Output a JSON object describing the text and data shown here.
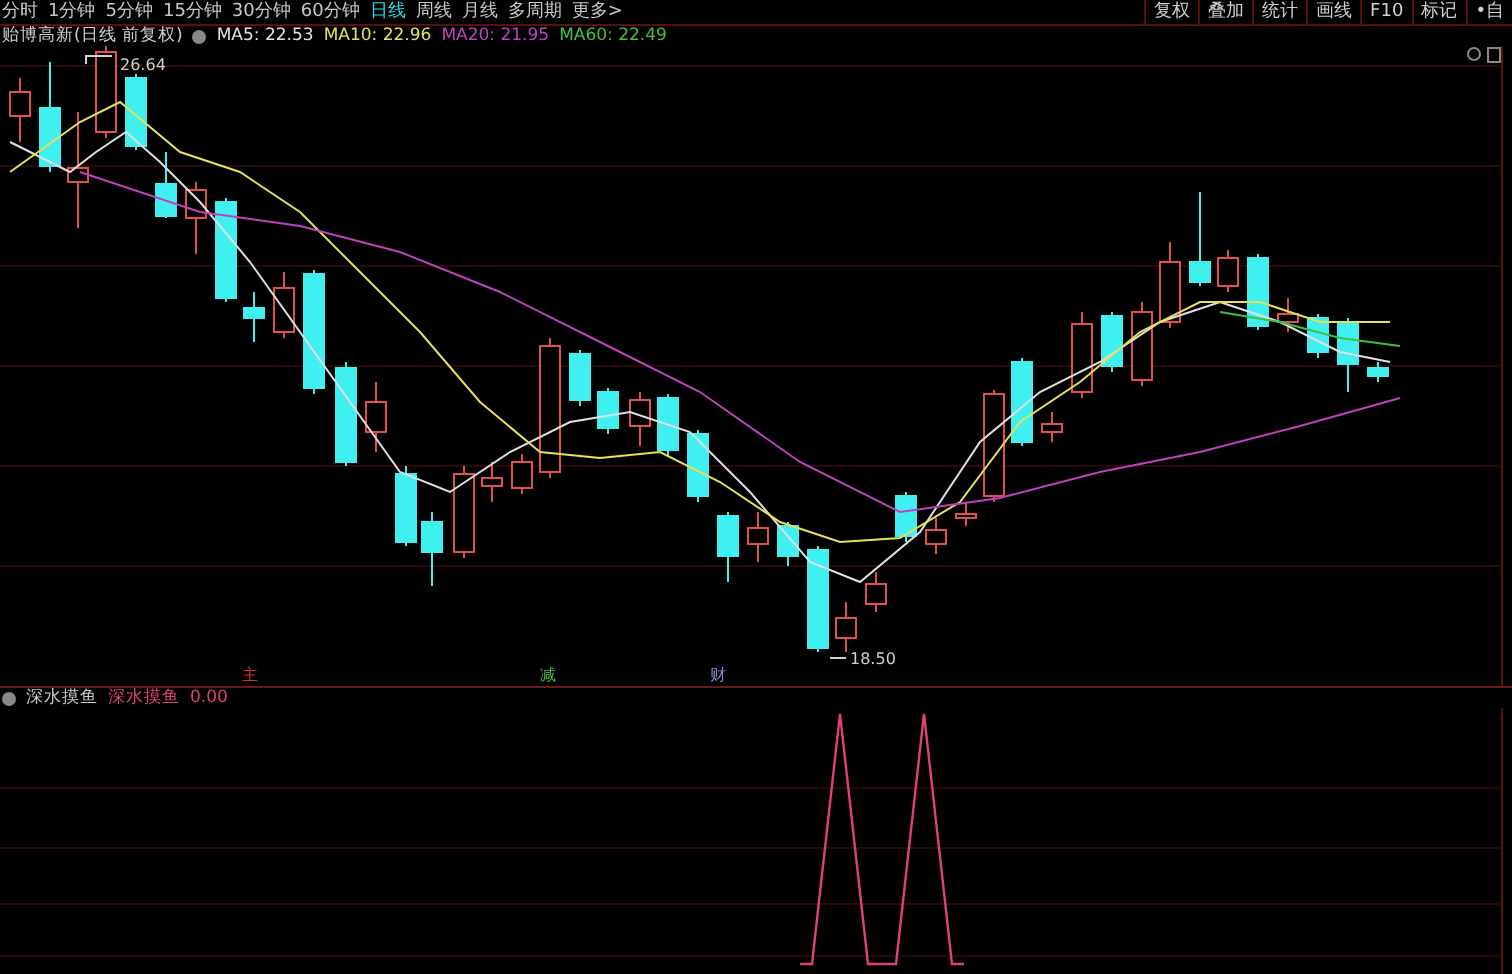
{
  "toolbar": {
    "periods": [
      {
        "label": "分时",
        "selected": false
      },
      {
        "label": "1分钟",
        "selected": false
      },
      {
        "label": "5分钟",
        "selected": false
      },
      {
        "label": "15分钟",
        "selected": false
      },
      {
        "label": "30分钟",
        "selected": false
      },
      {
        "label": "60分钟",
        "selected": false
      },
      {
        "label": "日线",
        "selected": true
      },
      {
        "label": "周线",
        "selected": false
      },
      {
        "label": "月线",
        "selected": false
      },
      {
        "label": "多周期",
        "selected": false
      },
      {
        "label": "更多>",
        "selected": false
      }
    ],
    "buttons": [
      "复权",
      "叠加",
      "统计",
      "画线",
      "F10",
      "标记",
      "•自"
    ]
  },
  "legend": {
    "title": "贻博高新(日线 前复权)",
    "ma": [
      {
        "label": "MA5: 22.53",
        "color": "#e0e0e0"
      },
      {
        "label": "MA10: 22.96",
        "color": "#e6e05a"
      },
      {
        "label": "MA20: 21.95",
        "color": "#c040c0"
      },
      {
        "label": "MA60: 22.49",
        "color": "#40c040"
      }
    ]
  },
  "main_chart": {
    "high_label": "26.64",
    "low_label": "18.50"
  },
  "events": [
    {
      "text": "主",
      "color": "#d03030"
    },
    {
      "text": "减",
      "color": "#40c040"
    },
    {
      "text": "财",
      "color": "#8090d0"
    }
  ],
  "indicator": {
    "name": "深水摸鱼",
    "series_label": "深水摸鱼",
    "value": "0.00"
  }
}
